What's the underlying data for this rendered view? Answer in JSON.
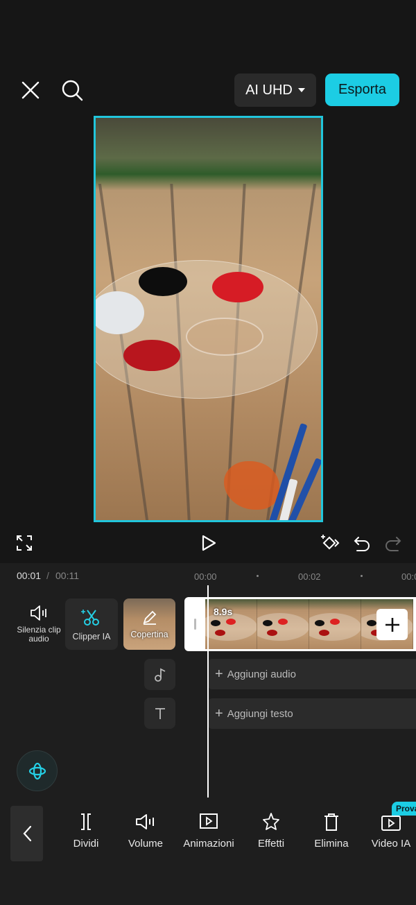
{
  "header": {
    "resolution_label": "AI UHD",
    "export_label": "Esporta"
  },
  "timeline": {
    "current_time": "00:01",
    "separator": "/",
    "total_time": "00:11",
    "ruler": [
      "00:00",
      "00:02",
      "00:0"
    ],
    "tools": {
      "mute_label": "Silenzia clip audio",
      "clipper_label": "Clipper IA",
      "cover_label": "Copertina"
    },
    "clip_duration": "8.9s",
    "add_audio_label": "Aggiungi audio",
    "add_text_label": "Aggiungi testo"
  },
  "toolbar": {
    "items": [
      {
        "label": "Dividi",
        "icon": "split-icon"
      },
      {
        "label": "Volume",
        "icon": "volume-icon"
      },
      {
        "label": "Animazioni",
        "icon": "animation-icon"
      },
      {
        "label": "Effetti",
        "icon": "effects-icon"
      },
      {
        "label": "Elimina",
        "icon": "trash-icon"
      },
      {
        "label": "Video IA",
        "icon": "video-ai-icon"
      }
    ],
    "badge": "Prova"
  },
  "colors": {
    "accent": "#1ccde4",
    "background": "#161616",
    "panel": "#1e1e1e"
  }
}
